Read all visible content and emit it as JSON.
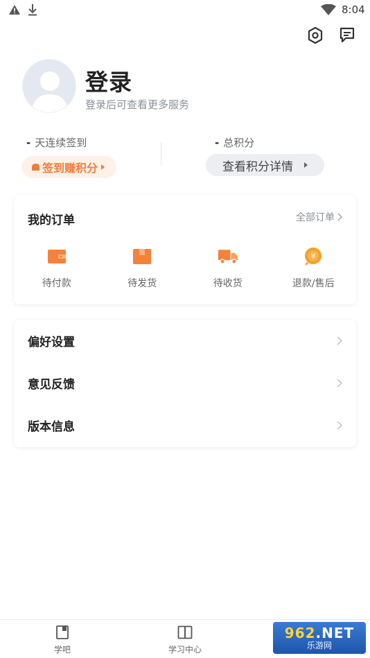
{
  "status_bar": {
    "time": "8:04"
  },
  "profile": {
    "title": "登录",
    "subtitle": "登录后可查看更多服务"
  },
  "stats": {
    "streak_value": "-",
    "streak_label": "天连续签到",
    "points_value": "-",
    "points_label": "总积分",
    "signin_button": "签到赚积分",
    "points_detail_button": "查看积分详情"
  },
  "orders": {
    "title": "我的订单",
    "all_link": "全部订单",
    "items": [
      {
        "label": "待付款",
        "icon": "wallet-icon"
      },
      {
        "label": "待发货",
        "icon": "box-icon"
      },
      {
        "label": "待收货",
        "icon": "truck-icon"
      },
      {
        "label": "退款/售后",
        "icon": "refund-icon"
      }
    ]
  },
  "settings": {
    "items": [
      {
        "label": "偏好设置"
      },
      {
        "label": "意见反馈"
      },
      {
        "label": "版本信息"
      }
    ]
  },
  "bottom_nav": {
    "items": [
      {
        "label": "学吧"
      },
      {
        "label": "学习中心"
      }
    ]
  },
  "watermark": {
    "line1": "962.NET",
    "line2": "乐游网"
  },
  "colors": {
    "accent_orange": "#f07d3a",
    "icon_orange": "#f5813a"
  }
}
